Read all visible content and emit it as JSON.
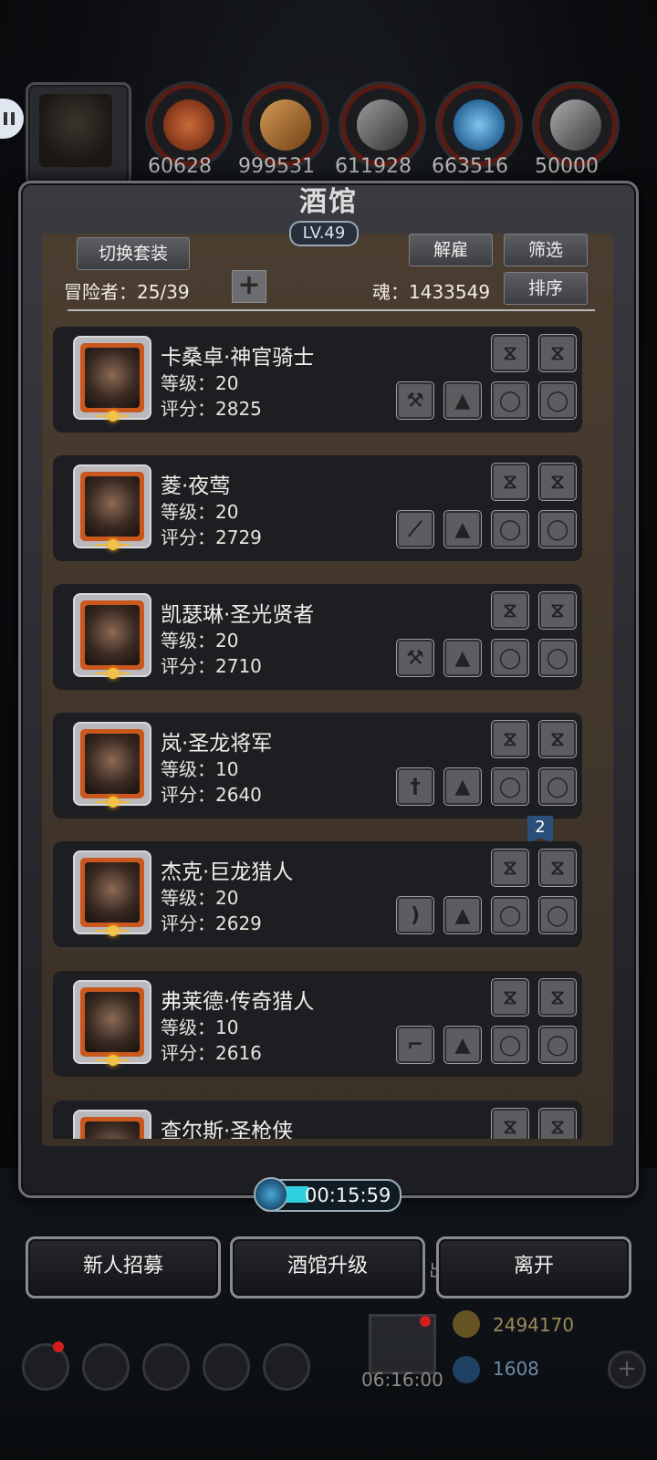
{
  "resources": {
    "values": [
      "60628",
      "999531",
      "611928",
      "663516",
      "50000"
    ],
    "colors": [
      "#b5532b",
      "#b77a3a",
      "#888888",
      "#3b7db8",
      "#777777"
    ]
  },
  "tavern": {
    "title": "酒馆",
    "level": "LV.49",
    "switch_outfit": "切换套装",
    "dismiss": "解雇",
    "filter": "筛选",
    "sort": "排序",
    "adventurers_label": "冒险者：25/39",
    "soul_label": "魂：1433549"
  },
  "heroes": [
    {
      "name": "卡桑卓·神官骑士",
      "level": "等级：20",
      "score": "评分：2825",
      "weapon": "axe"
    },
    {
      "name": "菱·夜莺",
      "level": "等级：20",
      "score": "评分：2729",
      "weapon": "blade"
    },
    {
      "name": "凯瑟琳·圣光贤者",
      "level": "等级：20",
      "score": "评分：2710",
      "weapon": "axe"
    },
    {
      "name": "岚·圣龙将军",
      "level": "等级：10",
      "score": "评分：2640",
      "weapon": "sword"
    },
    {
      "name": "杰克·巨龙猎人",
      "level": "等级：20",
      "score": "评分：2629",
      "weapon": "bow"
    },
    {
      "name": "弗莱德·传奇猎人",
      "level": "等级：10",
      "score": "评分：2616",
      "weapon": "gun"
    },
    {
      "name": "查尔斯·圣枪侠",
      "level": "",
      "score": "",
      "weapon": ""
    }
  ],
  "badge_value": "2",
  "timer": "00:15:59",
  "buttons": {
    "recruit": "新人招募",
    "upgrade": "酒馆升级",
    "leave": "离开"
  },
  "background_hud": {
    "gold": "2494170",
    "gems": "1608",
    "gift_timer": "06:16:00",
    "outpost_label": "出征"
  }
}
